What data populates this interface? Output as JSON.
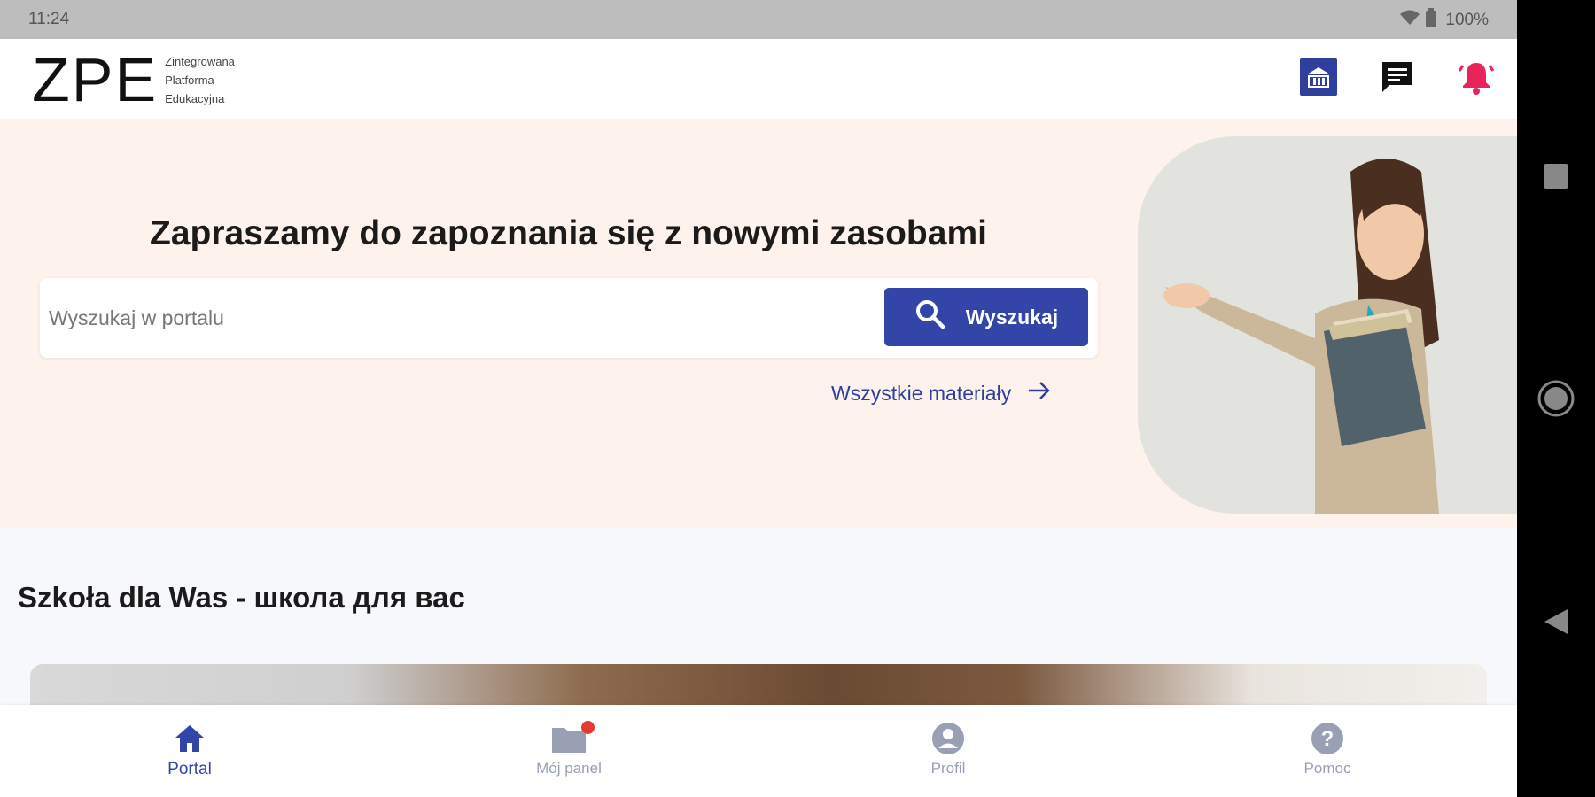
{
  "status_bar": {
    "time": "11:24",
    "battery": "100%"
  },
  "header": {
    "logo_mark": "ZPE",
    "logo_lines": [
      "Zintegrowana",
      "Platforma",
      "Edukacyjna"
    ],
    "icons": [
      "library-icon",
      "chat-icon",
      "notifications-icon"
    ]
  },
  "hero": {
    "title": "Zapraszamy do zapoznania się z nowymi zasobami",
    "search_placeholder": "Wyszukaj w portalu",
    "search_button": "Wyszukaj",
    "all_materials_link": "Wszystkie materiały"
  },
  "section": {
    "title": "Szkoła dla Was - школа для вас"
  },
  "bottom_nav": [
    {
      "label": "Portal",
      "icon": "home-icon",
      "active": true
    },
    {
      "label": "Mój panel",
      "icon": "folder-icon",
      "active": false,
      "badge": true
    },
    {
      "label": "Profil",
      "icon": "profile-icon",
      "active": false
    },
    {
      "label": "Pomoc",
      "icon": "help-icon",
      "active": false
    }
  ],
  "colors": {
    "primary": "#3346a8",
    "hero_bg": "#fdf3ec",
    "alert": "#e8245c"
  }
}
